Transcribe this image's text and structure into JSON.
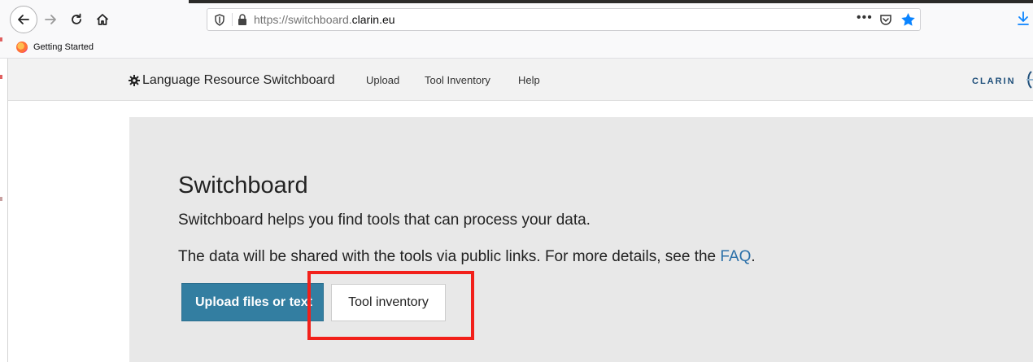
{
  "browser": {
    "url_prefix": "https://switchboard.",
    "url_domain": "clarin.eu",
    "more_label": "•••",
    "bookmarks": [
      {
        "label": "Getting Started"
      }
    ]
  },
  "site_nav": {
    "brand": "Language Resource Switchboard",
    "links": [
      {
        "label": "Upload"
      },
      {
        "label": "Tool Inventory"
      },
      {
        "label": "Help"
      }
    ],
    "logo_text": "CLARIN"
  },
  "main": {
    "title": "Switchboard",
    "intro": "Switchboard helps you find tools that can process your data.",
    "privacy_text": "The data will be shared with the tools via public links. For more details, see the ",
    "faq_link": "FAQ",
    "privacy_end": ".",
    "upload_button": "Upload files or text",
    "tools_button": "Tool inventory"
  },
  "colors": {
    "primary_button": "#337ea1",
    "link": "#2a6fa8",
    "highlight": "#f2201a",
    "bookmark_star": "#0a84ff"
  },
  "icons": [
    "back-arrow-icon",
    "forward-arrow-icon",
    "reload-icon",
    "home-icon",
    "shield-icon",
    "lock-icon",
    "pocket-icon",
    "star-icon",
    "download-icon",
    "firefox-icon",
    "cog-icon",
    "clarin-logo-icon"
  ]
}
